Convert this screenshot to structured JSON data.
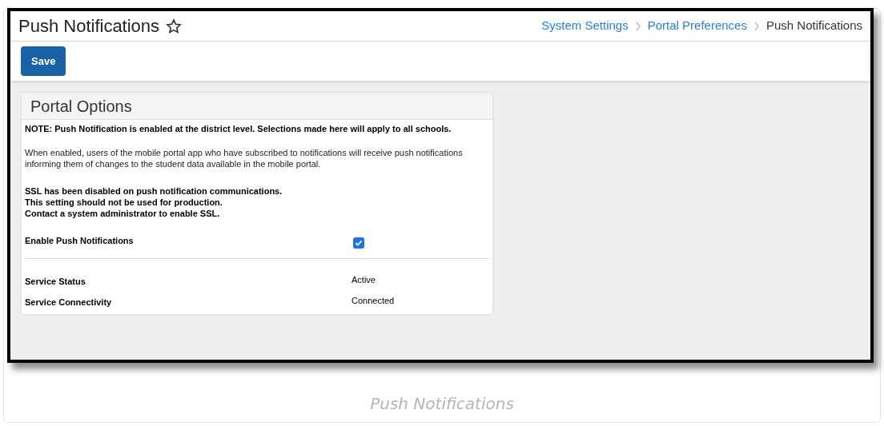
{
  "page": {
    "title": "Push Notifications",
    "favorite": false
  },
  "breadcrumb": [
    {
      "label": "System Settings",
      "link": true
    },
    {
      "label": "Portal Preferences",
      "link": true
    },
    {
      "label": "Push Notifications",
      "link": false
    }
  ],
  "toolbar": {
    "buttons": [
      "Save"
    ]
  },
  "panel": {
    "title": "Portal Options",
    "note": "NOTE: Push Notification is enabled at the district level. Selections made here will apply to all schools.",
    "description": "When enabled, users of the mobile portal app who have subscribed to notifications will receive push notifications informing them of changes to the student data available in the mobile portal.",
    "warning_lines": [
      "SSL has been disabled on push notification communications.",
      "This setting should not be used for production.",
      "Contact a system administrator to enable SSL."
    ],
    "setting": {
      "label": "Enable Push Notifications",
      "checked": true
    },
    "status_rows": [
      {
        "label": "Service Status",
        "value": "Active"
      },
      {
        "label": "Service Connectivity",
        "value": "Connected"
      }
    ]
  },
  "caption": "Push Notifications"
}
